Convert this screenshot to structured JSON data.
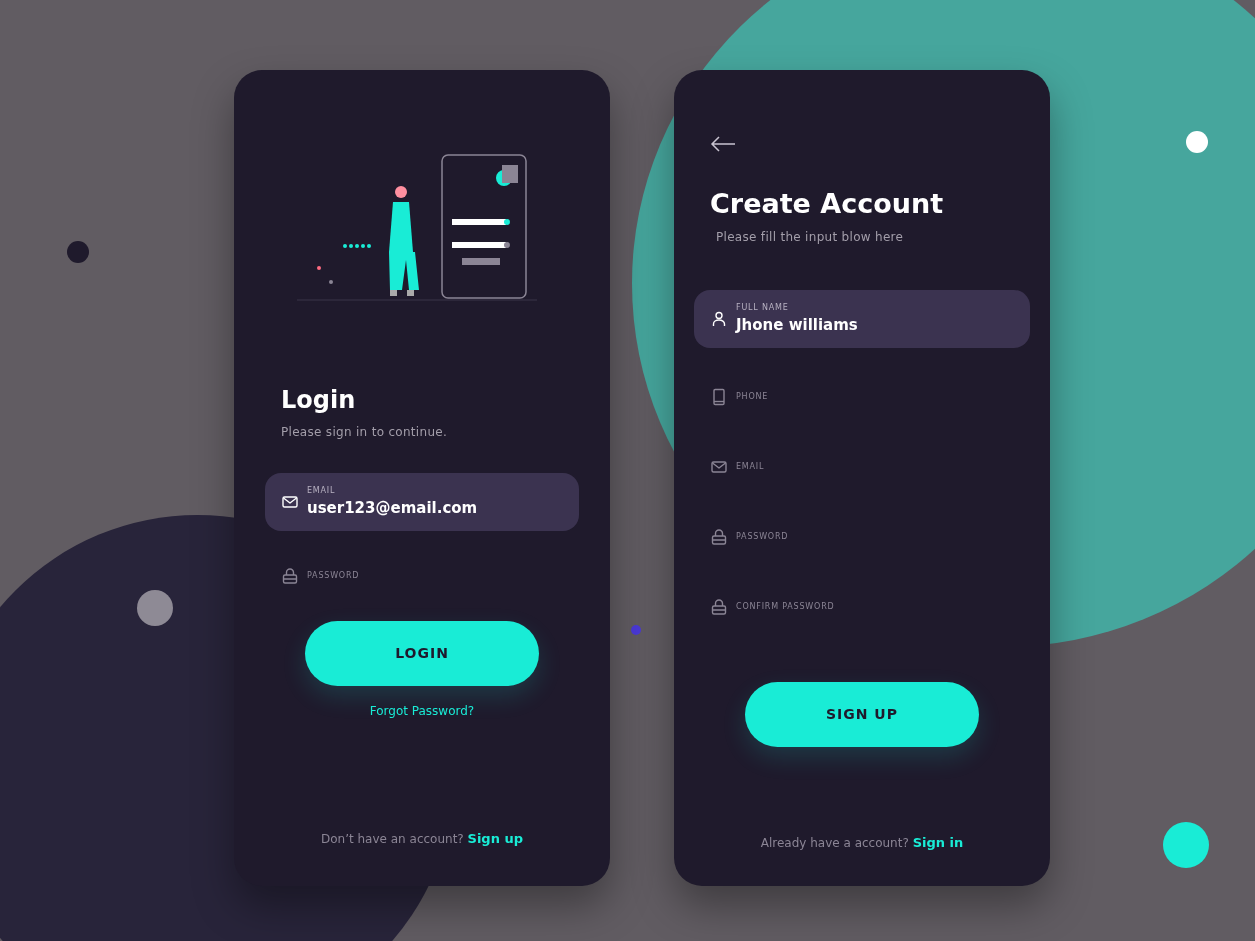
{
  "login": {
    "title": "Login",
    "subtitle": "Please sign in to continue.",
    "fields": [
      {
        "kind": "email",
        "label": "EMAIL",
        "value": "user123@email.com",
        "focused": true
      },
      {
        "kind": "password",
        "label": "PASSWORD",
        "focused": false
      }
    ],
    "button": "LOGIN",
    "forgot_link": "Forgot Password?",
    "footer": {
      "text": "Don’t have an account?",
      "link": "Sign up"
    }
  },
  "signup": {
    "title": "Create Account",
    "subtitle": "Please fill the input blow here",
    "fields": [
      {
        "kind": "user",
        "label": "FULL NAME",
        "value": "Jhone williams",
        "focused": true
      },
      {
        "kind": "phone",
        "label": "PHONE",
        "focused": false
      },
      {
        "kind": "email",
        "label": "EMAIL",
        "focused": false
      },
      {
        "kind": "password",
        "label": "PASSWORD",
        "focused": false
      },
      {
        "kind": "password",
        "label": "CONFIRM PASSWORD",
        "focused": false
      }
    ],
    "button": "SIGN UP",
    "footer": {
      "text": "Already have a account?",
      "link": "Sign in"
    }
  }
}
